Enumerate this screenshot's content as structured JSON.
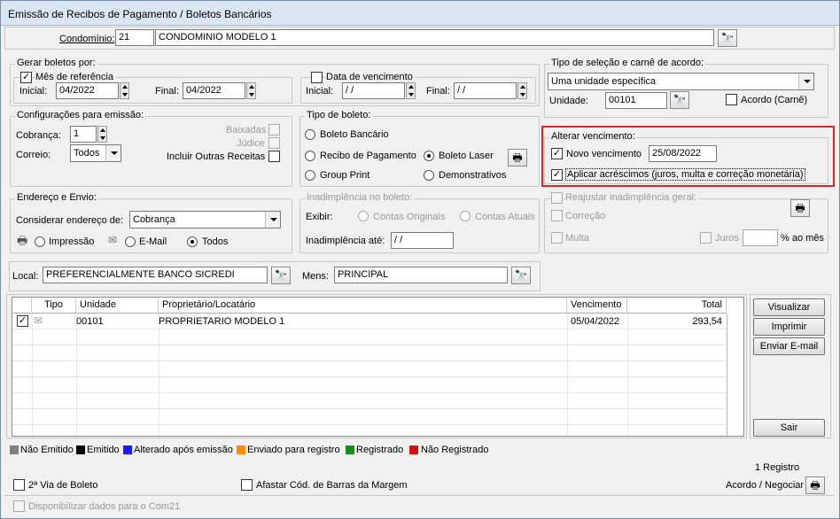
{
  "window": {
    "title": "Emissão de Recibos de Pagamento / Boletos Bancários"
  },
  "condominio": {
    "label": "Condomínio:",
    "code": "21",
    "name": "CONDOMINIO MODELO 1"
  },
  "gerar": {
    "title": "Gerar boletos por:",
    "mes_label": "Mês de referência",
    "inicial_label": "Inicial:",
    "inicial": "04/2022",
    "final_label": "Final:",
    "final": "04/2022",
    "venc_label": "Data de vencimento",
    "v_inicial": " / /",
    "v_final": " / /"
  },
  "tipo_selecao": {
    "title": "Tipo de seleção e carnê de acordo:",
    "combo": "Uma unidade específica",
    "unidade_label": "Unidade:",
    "unidade": "00101",
    "acordo_label": "Acordo (Carnê)"
  },
  "config": {
    "title": "Configurações para emissão:",
    "cobranca_label": "Cobrança:",
    "cobranca": "1",
    "correio_label": "Correio:",
    "correio": "Todos",
    "baixadas": "Baixadas",
    "judice": "Júdice",
    "outras": "Incluir Outras Receitas"
  },
  "tipo_boleto": {
    "title": "Tipo de boleto:",
    "bancario": "Boleto Bancário",
    "recibo": "Recibo de Pagamento",
    "laser": "Boleto Laser",
    "group": "Group Print",
    "demonstrativos": "Demonstrativos"
  },
  "alterar": {
    "title": "Alterar vencimento:",
    "novo_label": "Novo vencimento",
    "novo": "25/08/2022",
    "acrescimos": "Aplicar acréscimos (juros, multa e correção monetária)"
  },
  "endereco": {
    "title": "Endereço e Envio:",
    "considerar_label": "Considerar endereço de:",
    "considerar": "Cobrança",
    "impressao": "Impressão",
    "email": "E-Mail",
    "todos": "Todos"
  },
  "inad": {
    "title": "Inadimplência no boleto:",
    "exibir_label": "Exibir:",
    "originais": "Contas Originais",
    "atuais": "Contas Atuais",
    "ate_label": "Inadimplência até:",
    "ate": " / /"
  },
  "reajustar": {
    "title": "Reajustar inadimplência geral:",
    "correcao": "Correção",
    "multa": "Multa",
    "juros": "Juros",
    "ao_mes": "% ao mês"
  },
  "local": {
    "label": "Local:",
    "value": "PREFERENCIALMENTE BANCO SICREDI",
    "mens_label": "Mens:",
    "mens": "PRINCIPAL"
  },
  "table": {
    "headers": [
      "Tipo",
      "Unidade",
      "Proprietário/Locatário",
      "Vencimento",
      "Total"
    ],
    "rows": [
      {
        "unidade": "00101",
        "proprietario": "PROPRIETARIO MODELO 1",
        "vencimento": "05/04/2022",
        "total": "293,54"
      }
    ]
  },
  "buttons": {
    "visualizar": "Visualizar",
    "imprimir": "Imprimir",
    "enviar": "Enviar E-mail",
    "sair": "Sair"
  },
  "legend": [
    {
      "label": "Não Emitido",
      "color": "#808080"
    },
    {
      "label": "Emitido",
      "color": "#000000"
    },
    {
      "label": "Alterado após emissão",
      "color": "#1a1aff"
    },
    {
      "label": "Enviado para registro",
      "color": "#ff8c00"
    },
    {
      "label": "Registrado",
      "color": "#1a8a1a"
    },
    {
      "label": "Não Registrado",
      "color": "#d01010"
    }
  ],
  "footer": {
    "registros": "1 Registro",
    "segunda_via": "2ª Via de Boleto",
    "afastar": "Afastar Cód. de Barras da Margem",
    "acordo": "Acordo / Negociar",
    "com21": "Disponibilizar dados para o Com21"
  }
}
